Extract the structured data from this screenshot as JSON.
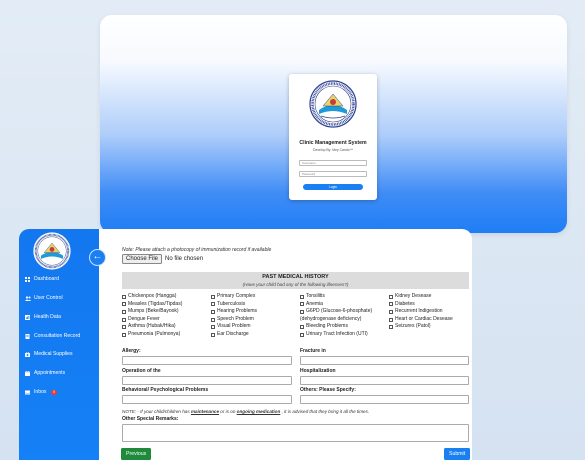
{
  "login": {
    "title": "Clinic Management System",
    "subtitle": "Develop By: Mey Cando™",
    "username_placeholder": "Username",
    "password_placeholder": "Password",
    "login_button": "Login"
  },
  "sidebar": {
    "items": [
      {
        "label": "Dashboard",
        "icon": "grid-icon"
      },
      {
        "label": "User Control",
        "icon": "users-icon"
      },
      {
        "label": "Health Data",
        "icon": "chart-icon"
      },
      {
        "label": "Consultation Record",
        "icon": "document-icon"
      },
      {
        "label": "Medical Supplies",
        "icon": "medkit-icon"
      },
      {
        "label": "Appointments",
        "icon": "calendar-icon"
      },
      {
        "label": "Inbox",
        "icon": "inbox-icon",
        "badge": "0"
      }
    ]
  },
  "form": {
    "note_top": "Note: Please attach a photocopy of immunization record if available",
    "file_button": "Choose File",
    "file_status": "No file chosen",
    "pmh_title": "PAST MEDICAL HISTORY",
    "pmh_subtitle": "(Have your child had any of the following illnesses?)",
    "col1": [
      "Chickenpox (Hangga)",
      "Measles (Tigdas/Tipdas)",
      "Mumps (Beke/Bayook)",
      "Dengue Fever",
      "Asthma (Hubak/Hika)",
      "Pneumonia (Pulmonya)"
    ],
    "col2": [
      "Primary Complex",
      "Tuberculosis",
      "Hearing Problems",
      "Speech Problem",
      "Visual Problem",
      "Ear Discharge"
    ],
    "col3": [
      "Tonsilitis",
      "Anemia",
      "G6PD (Glucose-6-phosphate)",
      "(dehydrogenase deficiency)",
      "Bleeding Problems",
      "Urinary Tract Infection (UTI)"
    ],
    "col4": [
      "Kidney Desease",
      "Diabetes",
      "Recurrent Indigestion",
      "Heart or Cardiac Desease",
      "Seizures (Patol)"
    ],
    "allergy": "Allergy:",
    "fracture": "Fracture in",
    "operation": "Operation of the",
    "hospitalization": "Hospitalization",
    "behavioral": "Behavioral/ Psychological Problems",
    "others": "Others: Please Specify:",
    "note_bottom_1": "NOTE: - If your child/children has ",
    "note_bottom_maint": "maintenance",
    "note_bottom_2": " or is on ",
    "note_bottom_med": "ongoing medication",
    "note_bottom_3": " , it is advised that they bring it all the times.",
    "remarks": "Other Special Remarks:",
    "previous_button": "Previous",
    "submit_button": "Submit"
  },
  "colors": {
    "primary": "#1a7ff0",
    "success": "#1f8a3b",
    "badge": "#ee3a3a"
  }
}
